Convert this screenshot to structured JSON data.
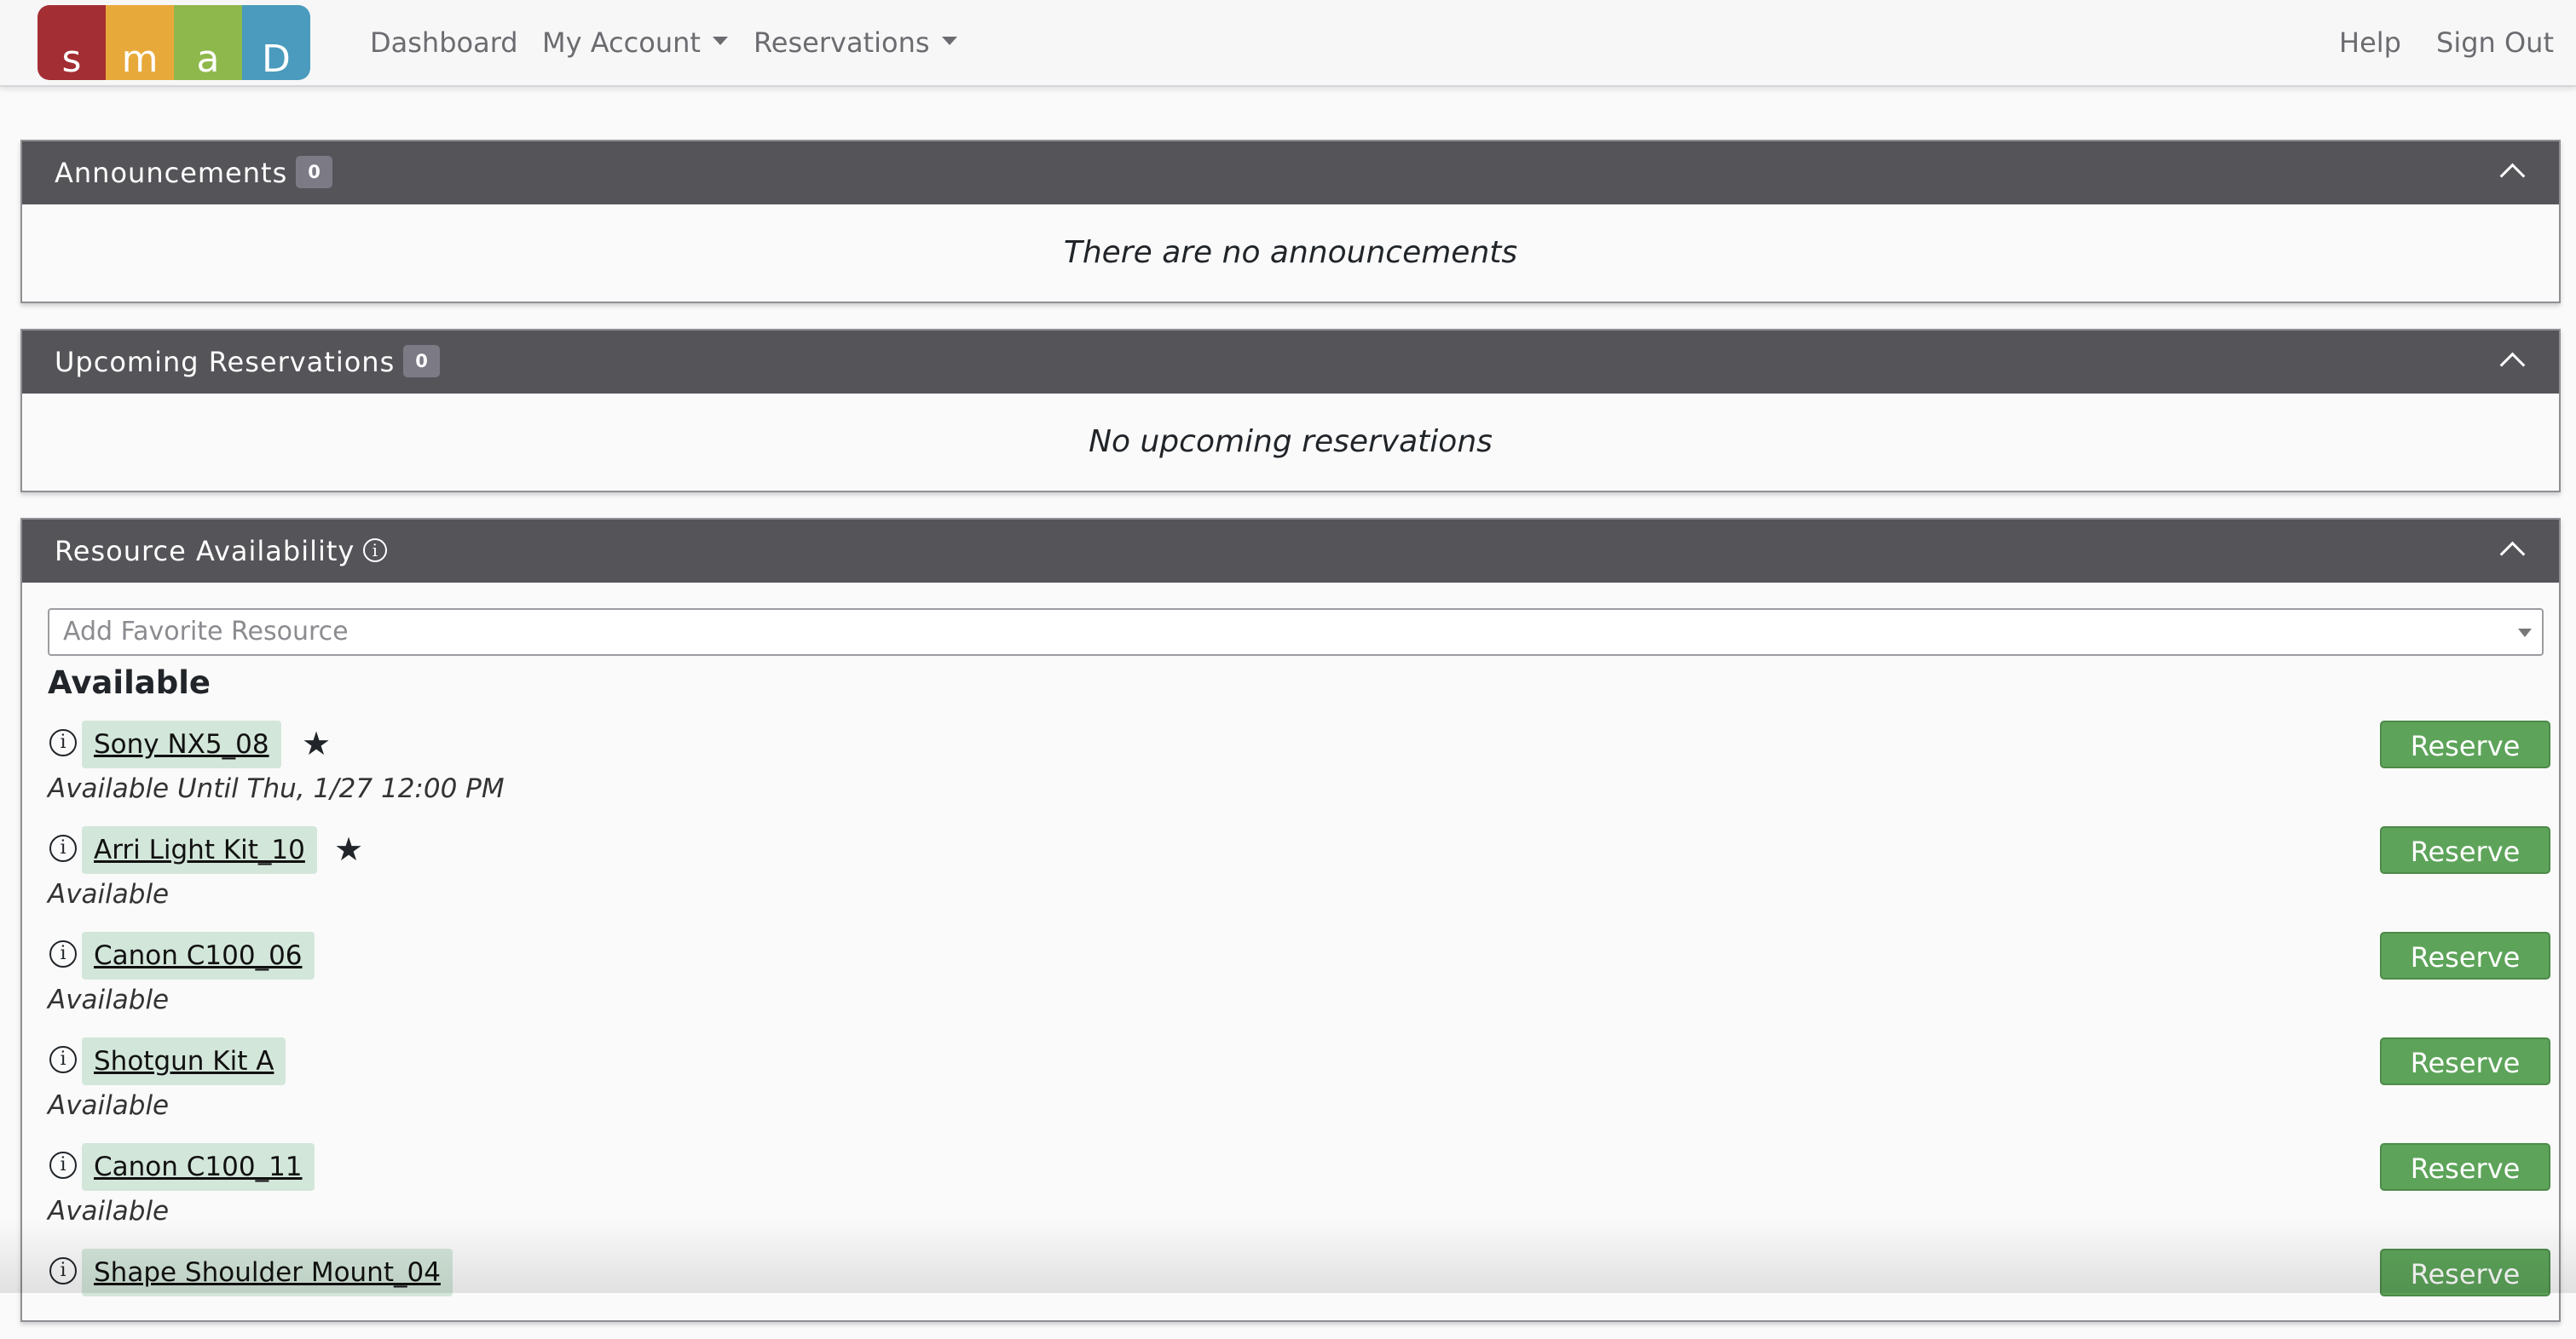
{
  "brand": {
    "letters": [
      "s",
      "m",
      "a",
      "D"
    ],
    "colors": [
      "#a32e34",
      "#e8a93b",
      "#8fb84c",
      "#4a9bbd"
    ]
  },
  "nav": {
    "dashboard": "Dashboard",
    "my_account": "My Account",
    "reservations": "Reservations",
    "help": "Help",
    "sign_out": "Sign Out"
  },
  "announcements": {
    "title": "Announcements",
    "count": "0",
    "empty_text": "There are no announcements"
  },
  "upcoming": {
    "title": "Upcoming Reservations",
    "count": "0",
    "empty_text": "No upcoming reservations"
  },
  "availability": {
    "title": "Resource Availability",
    "info_icon": "info-circle-icon",
    "favorite_placeholder": "Add Favorite Resource",
    "section_title": "Available",
    "reserve_label": "Reserve",
    "resources": [
      {
        "name": "Sony NX5_08",
        "status": "Available Until Thu, 1/27 12:00 PM",
        "favorite": true
      },
      {
        "name": "Arri Light Kit_10",
        "status": "Available",
        "favorite": true
      },
      {
        "name": "Canon C100_06",
        "status": "Available",
        "favorite": false
      },
      {
        "name": "Shotgun Kit A",
        "status": "Available",
        "favorite": false
      },
      {
        "name": "Canon C100_11",
        "status": "Available",
        "favorite": false
      },
      {
        "name": "Shape Shoulder Mount_04",
        "status": "",
        "favorite": false
      }
    ]
  },
  "colors": {
    "header_bg": "#555459",
    "reserve_green": "#5da45a",
    "resource_tag_bg": "#d3e6da"
  }
}
